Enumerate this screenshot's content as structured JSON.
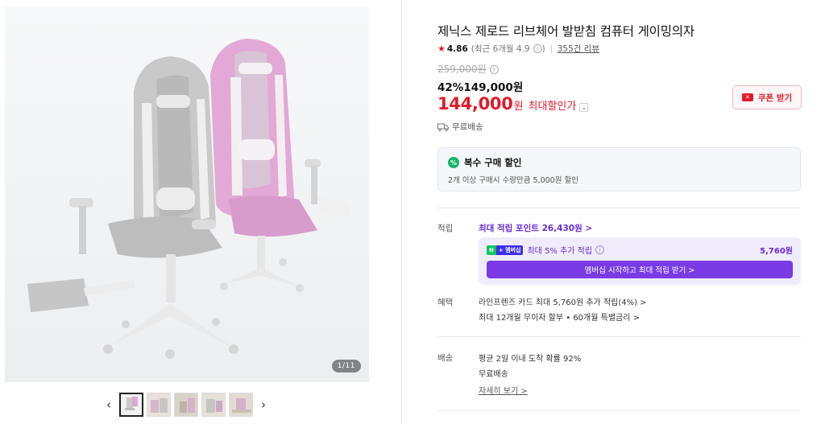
{
  "gallery": {
    "counter": "1/11",
    "prev_icon": "chevron-left-icon",
    "next_icon": "chevron-right-icon",
    "thumb_count": 5
  },
  "product": {
    "title": "제닉스 제로드 리브체어 발받침 컴퓨터 게이밍의자",
    "rating": "4.86",
    "rating_sub": "(최근 6개월 4.9",
    "rating_sub_end": ")",
    "review_count": "355건 리뷰",
    "original_price": "259,000원",
    "discount_rate": "42%",
    "sale_price": "149,000원",
    "final_price": "144,000",
    "final_unit": "원",
    "final_label": "최대할인가",
    "coupon_label": "쿠폰 받기",
    "shipping": "무료배송"
  },
  "bundle": {
    "title": "복수 구매 할인",
    "desc": "2개 이상 구매시 수량만큼 5,000원 할인"
  },
  "points": {
    "label": "적립",
    "max_points": "최대 적립 포인트 26,430원 >",
    "member_text": "최대 5% 추가 적립",
    "member_badge_n": "N",
    "member_badge_plus": "+ 멤버십",
    "member_amount": "5,760원",
    "member_button": "멤버십 시작하고 최대 적립 받기 >"
  },
  "benefits": {
    "label": "혜택",
    "line1": "라인프렌즈 카드 최대 5,760원 추가 적립(4%) >",
    "line2": "최대 12개월 무이자 할부 • 60개월 특별금리 >"
  },
  "delivery": {
    "label": "배송",
    "line1": "평균 2일 이내 도착 확률 92%",
    "line2": "무료배송",
    "detail": "자세히 보기 >"
  },
  "colors": {
    "accent_red": "#e11a2b",
    "purple": "#6b2bd9",
    "green": "#18b36a"
  }
}
